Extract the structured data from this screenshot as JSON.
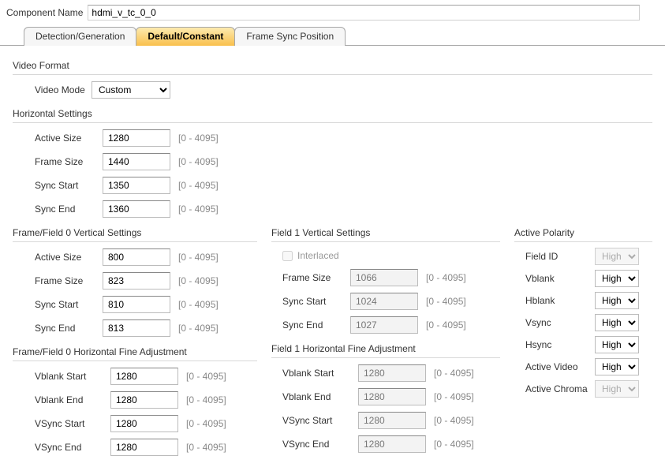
{
  "header": {
    "component_name_label": "Component Name",
    "component_name_value": "hdmi_v_tc_0_0"
  },
  "tabs": {
    "detection": "Detection/Generation",
    "default_constant": "Default/Constant",
    "frame_sync": "Frame Sync Position"
  },
  "video_format": {
    "title": "Video Format",
    "mode_label": "Video Mode",
    "mode_value": "Custom"
  },
  "horizontal": {
    "title": "Horizontal Settings",
    "active_size_label": "Active Size",
    "active_size": "1280",
    "frame_size_label": "Frame Size",
    "frame_size": "1440",
    "sync_start_label": "Sync Start",
    "sync_start": "1350",
    "sync_end_label": "Sync End",
    "sync_end": "1360"
  },
  "field0v": {
    "title": "Frame/Field 0 Vertical Settings",
    "active_size_label": "Active Size",
    "active_size": "800",
    "frame_size_label": "Frame Size",
    "frame_size": "823",
    "sync_start_label": "Sync Start",
    "sync_start": "810",
    "sync_end_label": "Sync End",
    "sync_end": "813"
  },
  "field0h": {
    "title": "Frame/Field 0 Horizontal Fine Adjustment",
    "vblank_start_label": "Vblank Start",
    "vblank_start": "1280",
    "vblank_end_label": "Vblank End",
    "vblank_end": "1280",
    "vsync_start_label": "VSync Start",
    "vsync_start": "1280",
    "vsync_end_label": "VSync End",
    "vsync_end": "1280"
  },
  "field1v": {
    "title": "Field 1 Vertical Settings",
    "interlaced_label": "Interlaced",
    "frame_size_label": "Frame Size",
    "frame_size": "1066",
    "sync_start_label": "Sync Start",
    "sync_start": "1024",
    "sync_end_label": "Sync End",
    "sync_end": "1027"
  },
  "field1h": {
    "title": "Field 1 Horizontal Fine Adjustment",
    "vblank_start_label": "Vblank Start",
    "vblank_start": "1280",
    "vblank_end_label": "Vblank End",
    "vblank_end": "1280",
    "vsync_start_label": "VSync Start",
    "vsync_start": "1280",
    "vsync_end_label": "VSync End",
    "vsync_end": "1280"
  },
  "polarity": {
    "title": "Active Polarity",
    "field_id_label": "Field ID",
    "field_id": "High",
    "vblank_label": "Vblank",
    "vblank": "High",
    "hblank_label": "Hblank",
    "hblank": "High",
    "vsync_label": "Vsync",
    "vsync": "High",
    "hsync_label": "Hsync",
    "hsync": "High",
    "active_video_label": "Active Video",
    "active_video": "High",
    "active_chroma_label": "Active Chroma",
    "active_chroma": "High"
  },
  "range_hint": "[0 - 4095]"
}
